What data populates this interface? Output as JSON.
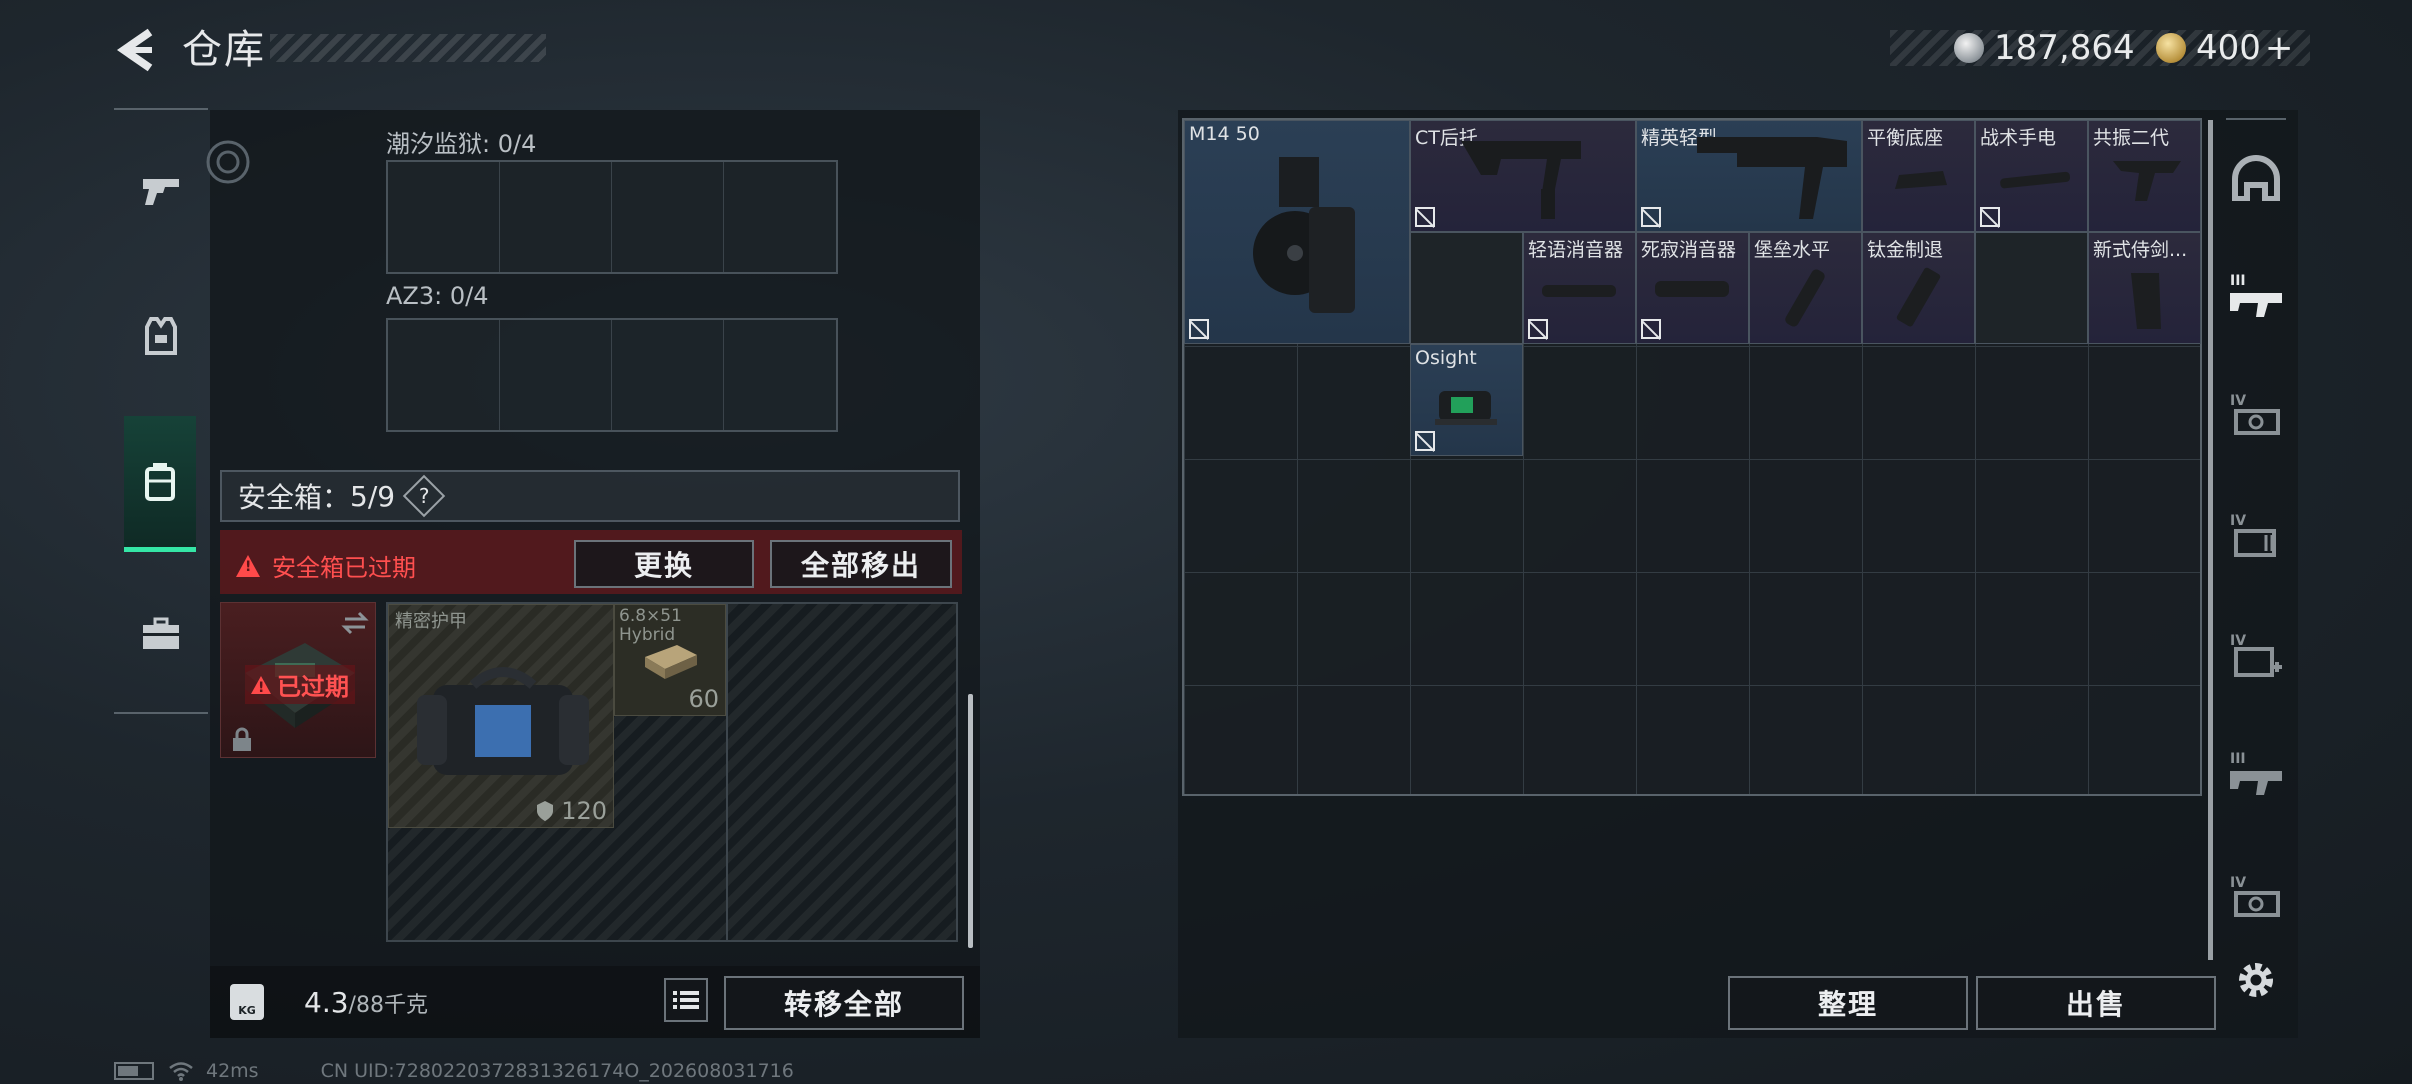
{
  "header": {
    "title": "仓库"
  },
  "currency": {
    "silver": "187,864",
    "gold": "400",
    "gold_plus": "+"
  },
  "left_nav": {
    "items": [
      {
        "id": "weapons",
        "icon": "pistol-icon"
      },
      {
        "id": "equipment",
        "icon": "vest-icon"
      },
      {
        "id": "containers",
        "icon": "backpack-icon"
      },
      {
        "id": "toolbox",
        "icon": "toolbox-icon"
      }
    ]
  },
  "containers": [
    {
      "label": "潮汐监狱: 0/4"
    },
    {
      "label": "AZ3: 0/4"
    }
  ],
  "safebox": {
    "label": "安全箱：",
    "count": "5/9",
    "help": "?",
    "expired_message": "安全箱已过期",
    "replace_label": "更换",
    "remove_all_label": "全部移出",
    "case_status": "已过期"
  },
  "safebox_items": [
    {
      "name": "精密护甲",
      "value": "120"
    },
    {
      "name": "6.8×51 Hybrid",
      "value": "60"
    }
  ],
  "bottom": {
    "weight_value": "4.3",
    "weight_capacity": "/88千克",
    "weight_badge": "KG",
    "transfer_all_label": "转移全部"
  },
  "stash_items": [
    {
      "name": "M14 50",
      "rarity": "blue"
    },
    {
      "name": "CT后托",
      "rarity": "purple"
    },
    {
      "name": "精英轻型",
      "rarity": "blue"
    },
    {
      "name": "平衡底座",
      "rarity": "purple"
    },
    {
      "name": "战术手电",
      "rarity": "purple"
    },
    {
      "name": "共振二代",
      "rarity": "purple"
    },
    {
      "name": "轻语消音器",
      "rarity": "purple"
    },
    {
      "name": "死寂消音器",
      "rarity": "purple"
    },
    {
      "name": "堡垒水平",
      "rarity": "purple"
    },
    {
      "name": "钛金制退",
      "rarity": "purple"
    },
    {
      "name": "新式侍剑...",
      "rarity": "purple"
    },
    {
      "name": "Osight",
      "rarity": "blue"
    }
  ],
  "actions": {
    "sort_label": "整理",
    "sell_label": "出售"
  },
  "side_tabs": [
    {
      "icon": "helmet-icon"
    },
    {
      "icon": "rifle-tier-icon",
      "tier": "III"
    },
    {
      "icon": "scope-tier-icon",
      "tier": "IV"
    },
    {
      "icon": "ammo-tier-icon",
      "tier": "IV"
    },
    {
      "icon": "medkit-tier-icon",
      "tier": "IV"
    },
    {
      "icon": "rifle-tier-icon",
      "tier": "III"
    },
    {
      "icon": "scope-tier-icon",
      "tier": "IV"
    }
  ],
  "status": {
    "ping": "42ms",
    "uid": "CN UID:7280220372831326174O_202608031716"
  },
  "colors": {
    "accent_green": "#35e6a6",
    "expired_red": "#ff4f4f",
    "rarity_blue": "#2b3f55",
    "rarity_purple": "#2c2a3c"
  }
}
